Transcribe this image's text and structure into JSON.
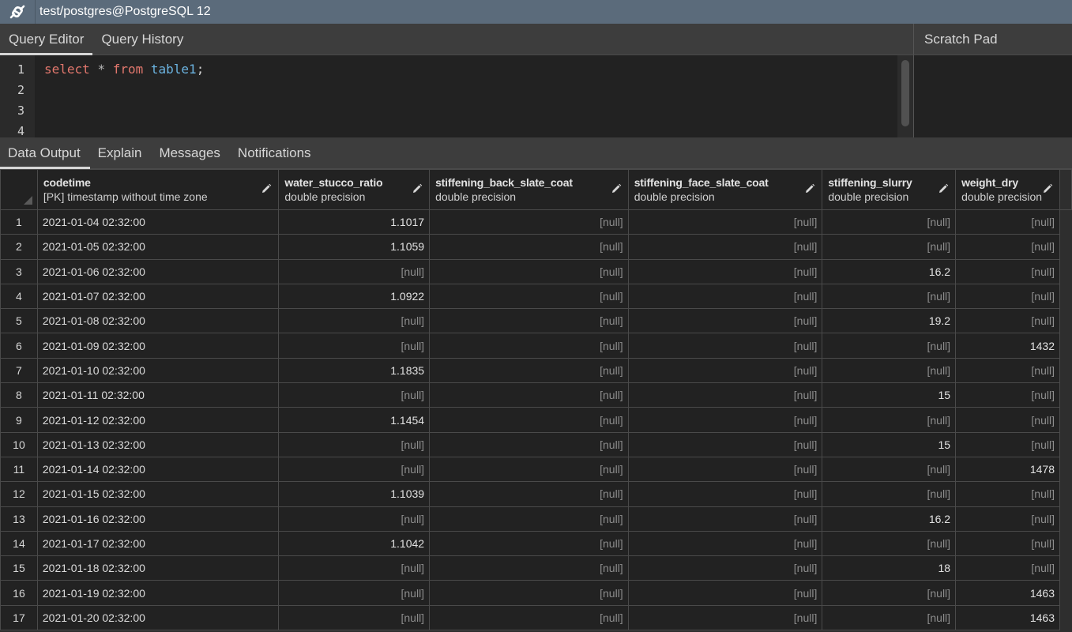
{
  "titlebar": {
    "title": "test/postgres@PostgreSQL 12",
    "icon": "connection-plug-icon"
  },
  "top_tabs": [
    {
      "label": "Query Editor",
      "active": true
    },
    {
      "label": "Query History",
      "active": false
    }
  ],
  "scratch_pad": {
    "label": "Scratch Pad"
  },
  "editor": {
    "line_numbers": [
      "1",
      "2",
      "3",
      "4"
    ],
    "code": {
      "kw1": "select",
      "star": "*",
      "kw2": "from",
      "table": "table1",
      "semi": ";"
    }
  },
  "result_tabs": [
    {
      "label": "Data Output",
      "active": true
    },
    {
      "label": "Explain",
      "active": false
    },
    {
      "label": "Messages",
      "active": false
    },
    {
      "label": "Notifications",
      "active": false
    }
  ],
  "grid": {
    "columns": [
      {
        "name": "codetime",
        "type": "[PK] timestamp without time zone"
      },
      {
        "name": "water_stucco_ratio",
        "type": "double precision"
      },
      {
        "name": "stiffening_back_slate_coat",
        "type": "double precision"
      },
      {
        "name": "stiffening_face_slate_coat",
        "type": "double precision"
      },
      {
        "name": "stiffening_slurry",
        "type": "double precision"
      },
      {
        "name": "weight_dry",
        "type": "double precision"
      }
    ],
    "null_text": "[null]",
    "rows": [
      {
        "n": "1",
        "cells": [
          "2021-01-04 02:32:00",
          "1.1017",
          null,
          null,
          null,
          null
        ]
      },
      {
        "n": "2",
        "cells": [
          "2021-01-05 02:32:00",
          "1.1059",
          null,
          null,
          null,
          null
        ]
      },
      {
        "n": "3",
        "cells": [
          "2021-01-06 02:32:00",
          null,
          null,
          null,
          "16.2",
          null
        ]
      },
      {
        "n": "4",
        "cells": [
          "2021-01-07 02:32:00",
          "1.0922",
          null,
          null,
          null,
          null
        ]
      },
      {
        "n": "5",
        "cells": [
          "2021-01-08 02:32:00",
          null,
          null,
          null,
          "19.2",
          null
        ]
      },
      {
        "n": "6",
        "cells": [
          "2021-01-09 02:32:00",
          null,
          null,
          null,
          null,
          "1432"
        ]
      },
      {
        "n": "7",
        "cells": [
          "2021-01-10 02:32:00",
          "1.1835",
          null,
          null,
          null,
          null
        ]
      },
      {
        "n": "8",
        "cells": [
          "2021-01-11 02:32:00",
          null,
          null,
          null,
          "15",
          null
        ]
      },
      {
        "n": "9",
        "cells": [
          "2021-01-12 02:32:00",
          "1.1454",
          null,
          null,
          null,
          null
        ]
      },
      {
        "n": "10",
        "cells": [
          "2021-01-13 02:32:00",
          null,
          null,
          null,
          "15",
          null
        ]
      },
      {
        "n": "11",
        "cells": [
          "2021-01-14 02:32:00",
          null,
          null,
          null,
          null,
          "1478"
        ]
      },
      {
        "n": "12",
        "cells": [
          "2021-01-15 02:32:00",
          "1.1039",
          null,
          null,
          null,
          null
        ]
      },
      {
        "n": "13",
        "cells": [
          "2021-01-16 02:32:00",
          null,
          null,
          null,
          "16.2",
          null
        ]
      },
      {
        "n": "14",
        "cells": [
          "2021-01-17 02:32:00",
          "1.1042",
          null,
          null,
          null,
          null
        ]
      },
      {
        "n": "15",
        "cells": [
          "2021-01-18 02:32:00",
          null,
          null,
          null,
          "18",
          null
        ]
      },
      {
        "n": "16",
        "cells": [
          "2021-01-19 02:32:00",
          null,
          null,
          null,
          null,
          "1463"
        ]
      },
      {
        "n": "17",
        "cells": [
          "2021-01-20 02:32:00",
          null,
          null,
          null,
          null,
          "1463"
        ]
      }
    ]
  }
}
